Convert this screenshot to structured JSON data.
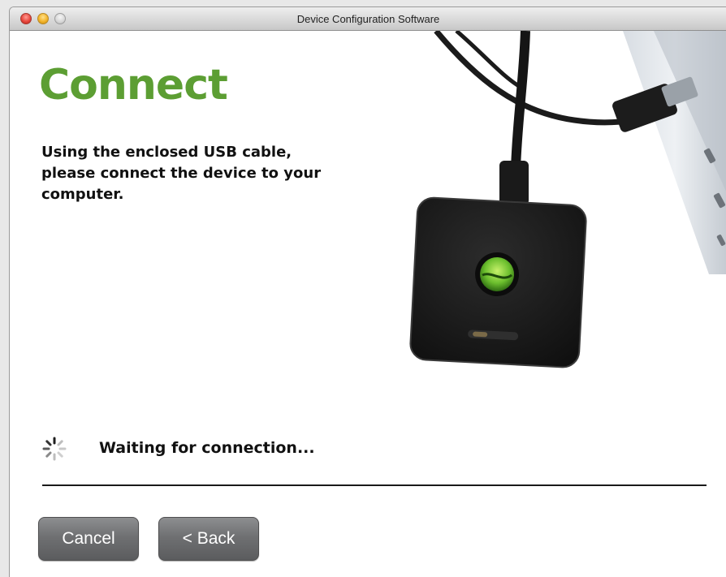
{
  "window": {
    "title": "Device Configuration Software"
  },
  "page": {
    "heading": "Connect",
    "instructions": "Using the enclosed USB cable, please connect the device to your computer.",
    "status": "Waiting for connection..."
  },
  "buttons": {
    "cancel_label": "Cancel",
    "back_label": "< Back"
  },
  "icons": {
    "spinner": "loading-spinner-icon",
    "device": "usb-device-illustration"
  },
  "colors": {
    "heading_green": "#5c9e33",
    "button_gray": "#6f7072",
    "close_red": "#e8473d",
    "minimize_yellow": "#f2b42b"
  }
}
